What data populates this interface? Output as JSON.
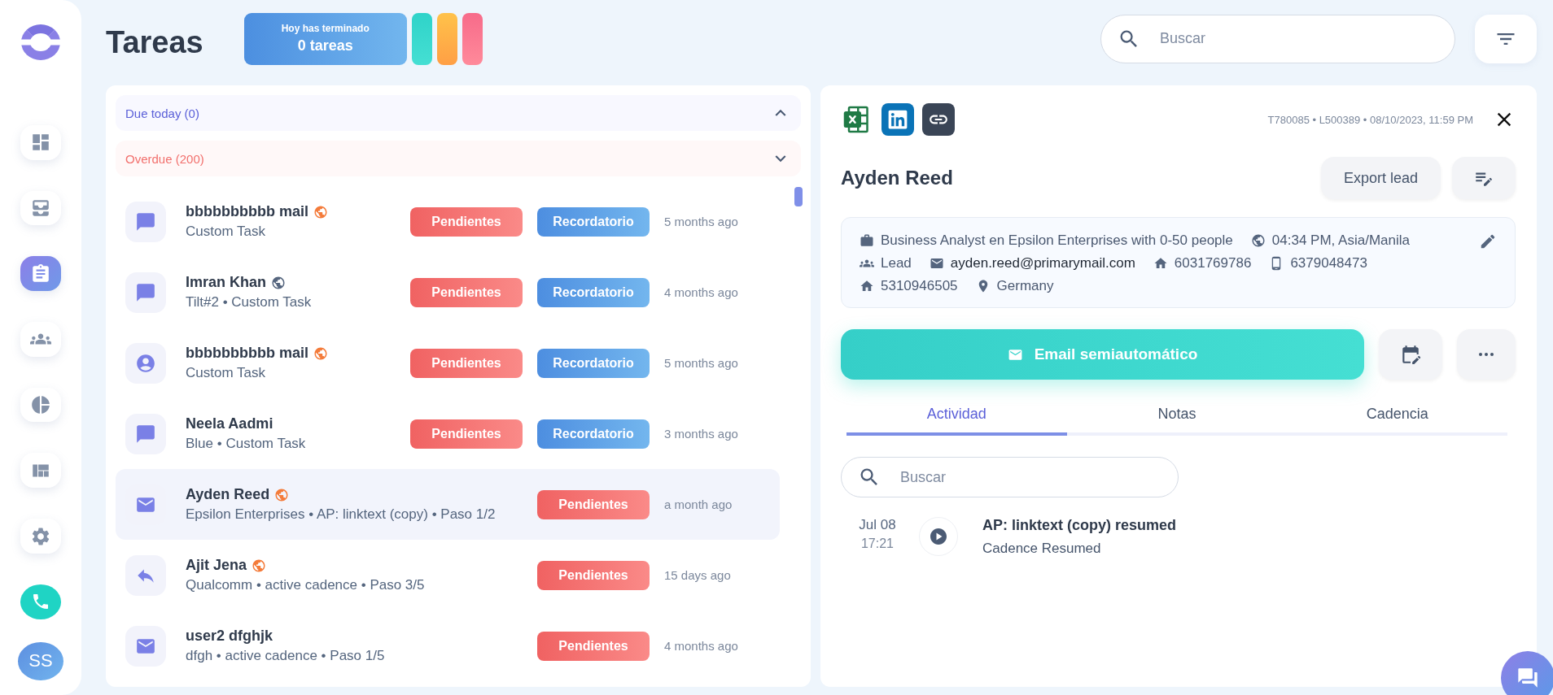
{
  "page": {
    "title": "Tareas"
  },
  "summary": {
    "caption": "Hoy has terminado",
    "count": "0 tareas"
  },
  "search": {
    "placeholder": "Buscar"
  },
  "sidebar": {
    "items": [
      {
        "kind": "dashboard",
        "selected": false
      },
      {
        "kind": "inbox",
        "selected": false
      },
      {
        "kind": "tasks",
        "selected": true
      },
      {
        "kind": "contacts",
        "selected": false
      },
      {
        "kind": "reports",
        "selected": false
      },
      {
        "kind": "templates",
        "selected": false
      },
      {
        "kind": "settings",
        "selected": false
      }
    ],
    "avatar": "SS"
  },
  "sections": [
    {
      "label": "Due today (0)",
      "kind": "today",
      "expanded": true
    },
    {
      "label": "Overdue (200)",
      "kind": "overdue",
      "expanded": false
    }
  ],
  "tasks": [
    {
      "kind": "chat",
      "name": "bbbbbbbbbb mail",
      "timezone": {
        "color": "#f47b3a"
      },
      "subtitle": "Custom Task",
      "status": "Pendientes",
      "reminder": "Recordatorio",
      "time": "5 months ago",
      "selected": false
    },
    {
      "kind": "chat",
      "name": "Imran Khan",
      "timezone": {
        "color": "#55657e"
      },
      "subtitle": "Tilt#2 • Custom Task",
      "status": "Pendientes",
      "reminder": "Recordatorio",
      "time": "4 months ago",
      "selected": false
    },
    {
      "kind": "contact",
      "name": "bbbbbbbbbb mail",
      "timezone": {
        "color": "#f47b3a"
      },
      "subtitle": "Custom Task",
      "status": "Pendientes",
      "reminder": "Recordatorio",
      "time": "5 months ago",
      "selected": false
    },
    {
      "kind": "chat",
      "name": "Neela Aadmi",
      "subtitle": "Blue • Custom Task",
      "status": "Pendientes",
      "reminder": "Recordatorio",
      "time": "3 months ago",
      "selected": false
    },
    {
      "kind": "email",
      "name": "Ayden Reed",
      "timezone": {
        "color": "#f47b3a"
      },
      "subtitle": "Epsilon Enterprises • AP: linktext (copy) • Paso 1/2",
      "status": "Pendientes",
      "time": "a month ago",
      "selected": true
    },
    {
      "kind": "reply",
      "name": "Ajit Jena",
      "timezone": {
        "color": "#f47b3a"
      },
      "subtitle": "Qualcomm • active cadence • Paso 3/5",
      "status": "Pendientes",
      "time": "15 days ago",
      "selected": false
    },
    {
      "kind": "email",
      "name": "user2 dfghjk",
      "subtitle": "dfgh • active cadence • Paso 1/5",
      "status": "Pendientes",
      "time": "4 months ago",
      "selected": false
    }
  ],
  "detail": {
    "meta": "T780085 • L500389 • 08/10/2023, 11:59 PM",
    "name": "Ayden Reed",
    "export_button": "Export lead",
    "info": [
      {
        "kind": "job",
        "text": "Business Analyst en Epsilon Enterprises with 0-50 people"
      },
      {
        "kind": "timezone",
        "text": "04:34 PM, Asia/Manila"
      },
      {
        "kind": "stage",
        "text": "Lead"
      },
      {
        "kind": "email",
        "text": "ayden.reed@primarymail.com"
      },
      {
        "kind": "home",
        "text": "6031769786"
      },
      {
        "kind": "mobile",
        "text": "6379048473"
      },
      {
        "kind": "home",
        "text": "5310946505"
      },
      {
        "kind": "location",
        "text": "Germany"
      }
    ],
    "primary_action": "Email semiautomático",
    "tabs": [
      {
        "label": "Actividad",
        "selected": true
      },
      {
        "label": "Notas",
        "selected": false
      },
      {
        "label": "Cadencia",
        "selected": false
      }
    ],
    "search": {
      "placeholder": "Buscar"
    },
    "activity": [
      {
        "date": "Jul 08",
        "time": "17:21",
        "title": "AP: linktext (copy) resumed",
        "description": "Cadence Resumed"
      }
    ]
  }
}
